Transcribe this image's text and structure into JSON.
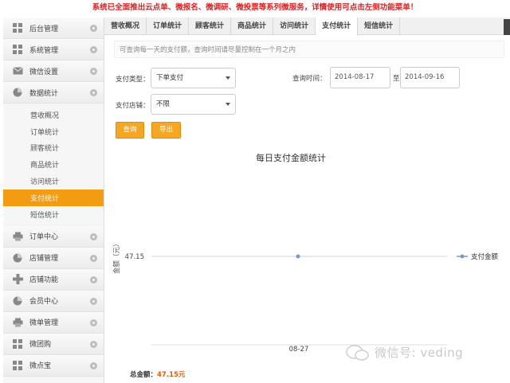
{
  "banner": "系统已全面推出云点单、微报名、微调研、微投票等系列微服务，详情使用可点击左侧功能菜单！",
  "sidebar": {
    "items": [
      {
        "label": "后台管理",
        "icon": "grid-icon"
      },
      {
        "label": "系统管理",
        "icon": "grid-icon"
      },
      {
        "label": "微信设置",
        "icon": "envelope-icon"
      },
      {
        "label": "数据统计",
        "icon": "pie-chart-icon"
      }
    ],
    "subitems": [
      "营收概况",
      "订单统计",
      "顾客统计",
      "商品统计",
      "访问统计",
      "支付统计",
      "短信统计"
    ],
    "active_sub": "支付统计",
    "items_after": [
      {
        "label": "订单中心",
        "icon": "printer-icon"
      },
      {
        "label": "店铺管理",
        "icon": "pie-chart-icon"
      },
      {
        "label": "店铺功能",
        "icon": "plus-icon"
      },
      {
        "label": "会员中心",
        "icon": "pie-chart-icon"
      },
      {
        "label": "微单管理",
        "icon": "printer-icon"
      },
      {
        "label": "微团购",
        "icon": "grid-icon"
      },
      {
        "label": "微点宝",
        "icon": "grid-icon"
      }
    ]
  },
  "tabs": [
    "营收概况",
    "订单统计",
    "顾客统计",
    "商品统计",
    "访问统计",
    "支付统计",
    "短信统计"
  ],
  "active_tab": "支付统计",
  "notice": "可查询每一天的支付额，查询时间请尽量控制在一个月之内",
  "form": {
    "pay_type_label": "支付类型：",
    "pay_type_value": "下单支付",
    "store_label": "支付店铺：",
    "store_value": "不限",
    "query_time_label": "查询时间：",
    "date_from": "2014-08-17",
    "date_sep": "至",
    "date_to": "2014-09-16",
    "query_btn": "查询",
    "export_btn": "导出"
  },
  "chart_data": {
    "type": "line",
    "title": "每日支付金额统计",
    "ylabel": "金额（元）",
    "xlabel": "",
    "categories": [
      "08-27"
    ],
    "series": [
      {
        "name": "支付金额",
        "values": [
          47.15
        ]
      }
    ],
    "y_tick_labels": [
      "47.15"
    ],
    "legend": "right",
    "grid": false,
    "color": "#7799cc"
  },
  "total": {
    "label": "总金额：",
    "value": "47.15元"
  },
  "watermark": "微信号: veding"
}
